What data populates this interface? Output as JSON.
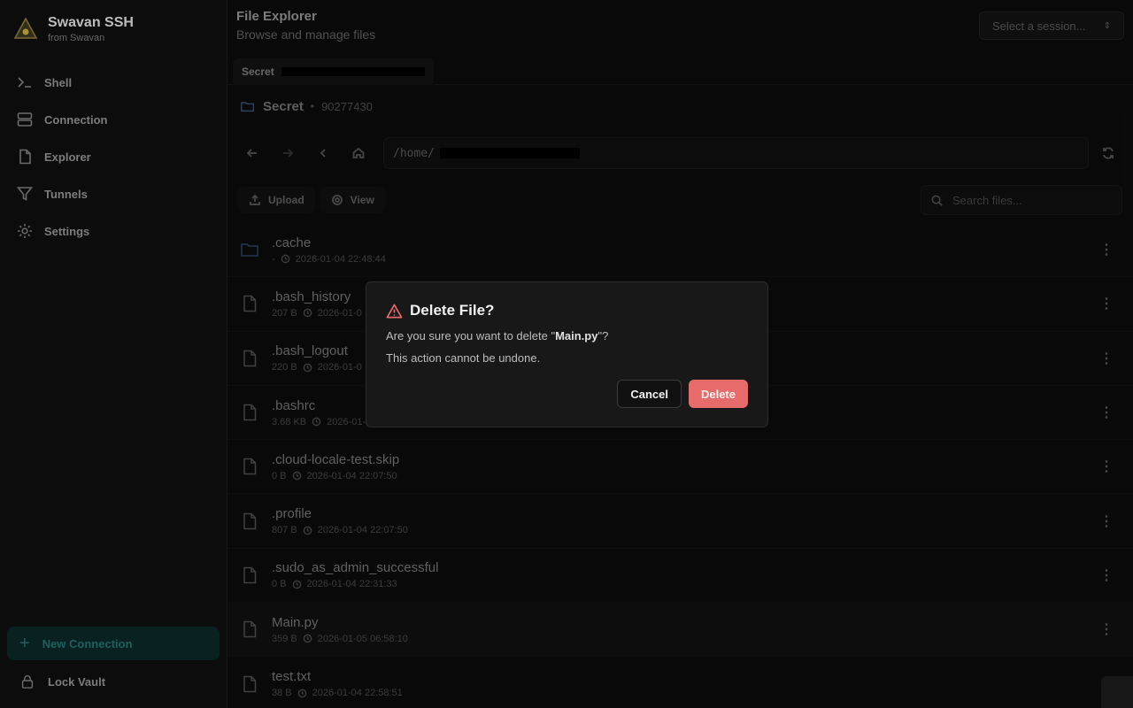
{
  "brand": {
    "title": "Swavan SSH",
    "subtitle": "from Swavan"
  },
  "sidebar": {
    "items": [
      {
        "label": "Shell",
        "icon": "terminal-icon"
      },
      {
        "label": "Connection",
        "icon": "server-icon"
      },
      {
        "label": "Explorer",
        "icon": "file-icon"
      },
      {
        "label": "Tunnels",
        "icon": "filter-icon"
      },
      {
        "label": "Settings",
        "icon": "gear-icon"
      }
    ],
    "new_connection": "New Connection",
    "lock_vault": "Lock Vault"
  },
  "header": {
    "title": "File Explorer",
    "subtitle": "Browse and manage files",
    "session_placeholder": "Select a session..."
  },
  "tab": {
    "label": "Secret"
  },
  "connection": {
    "name": "Secret",
    "port": "90277430"
  },
  "path": {
    "prefix": "/home/"
  },
  "toolbar": {
    "upload": "Upload",
    "view": "View",
    "search_placeholder": "Search files..."
  },
  "files": [
    {
      "name": ".cache",
      "size": "-",
      "date": "2026-01-04 22:48:44",
      "type": "folder"
    },
    {
      "name": ".bash_history",
      "size": "207 B",
      "date": "2026-01-0",
      "type": "file"
    },
    {
      "name": ".bash_logout",
      "size": "220 B",
      "date": "2026-01-0",
      "type": "file"
    },
    {
      "name": ".bashrc",
      "size": "3.68 KB",
      "date": "2026-01-0",
      "type": "file"
    },
    {
      "name": ".cloud-locale-test.skip",
      "size": "0 B",
      "date": "2026-01-04 22:07:50",
      "type": "file"
    },
    {
      "name": ".profile",
      "size": "807 B",
      "date": "2026-01-04 22:07:50",
      "type": "file"
    },
    {
      "name": ".sudo_as_admin_successful",
      "size": "0 B",
      "date": "2026-01-04 22:31:33",
      "type": "file"
    },
    {
      "name": "Main.py",
      "size": "359 B",
      "date": "2026-01-05 06:58:10",
      "type": "file"
    },
    {
      "name": "test.txt",
      "size": "38 B",
      "date": "2026-01-04 22:58:51",
      "type": "file"
    }
  ],
  "modal": {
    "title": "Delete File?",
    "text_prefix": "Are you sure you want to delete \"",
    "filename": "Main.py",
    "text_suffix": "\"?",
    "warning": "This action cannot be undone.",
    "cancel": "Cancel",
    "delete": "Delete"
  },
  "colors": {
    "danger": "#e86b6b",
    "accent": "#0c2626"
  }
}
